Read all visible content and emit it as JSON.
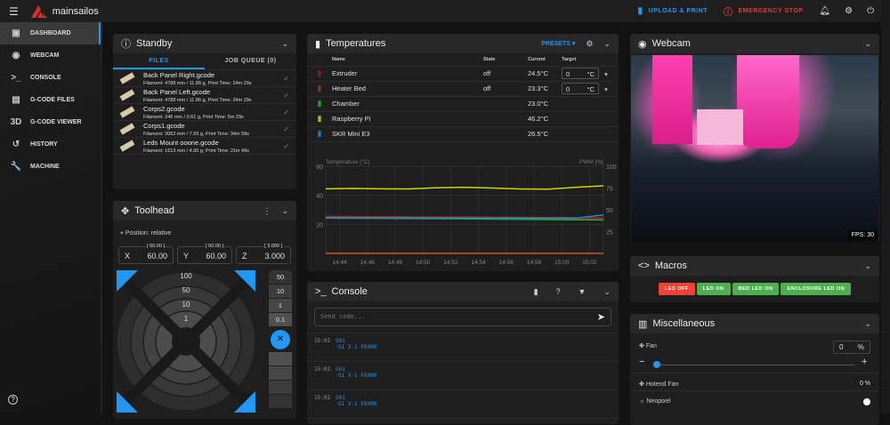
{
  "app": {
    "name": "mainsailos"
  },
  "topbar": {
    "upload": "UPLOAD & PRINT",
    "estop": "EMERGENCY STOP"
  },
  "sidebar": {
    "items": [
      {
        "label": "DASHBOARD",
        "icon": "▣"
      },
      {
        "label": "WEBCAM",
        "icon": "◉"
      },
      {
        "label": "CONSOLE",
        "icon": ">_"
      },
      {
        "label": "G-CODE FILES",
        "icon": "▤"
      },
      {
        "label": "G-CODE VIEWER",
        "icon": "3D"
      },
      {
        "label": "HISTORY",
        "icon": "↺"
      },
      {
        "label": "MACHINE",
        "icon": "🔧"
      }
    ],
    "help": "?"
  },
  "standby": {
    "title": "Standby",
    "tabs": [
      "FILES",
      "JOB QUEUE (0)"
    ],
    "files": [
      {
        "name": "Back Panel Right.gcode",
        "meta": "Filament: 4788 mm / 11.86 g, Print Time: 24m 29s"
      },
      {
        "name": "Back Panel Left.gcode",
        "meta": "Filament: 4788 mm / 11.86 g, Print Time: 24m 29s"
      },
      {
        "name": "Corps2.gcode",
        "meta": "Filament: 246 mm / 0.61 g, Print Time: 5m 29s"
      },
      {
        "name": "Corps1.gcode",
        "meta": "Filament: 3062 mm / 7.59 g, Print Time: 34m 58s"
      },
      {
        "name": "Leds Mount ooone.gcode",
        "meta": "Filament: 1613 mm / 4.00 g, Print Time: 21m 49s"
      }
    ]
  },
  "toolhead": {
    "title": "Toolhead",
    "position": "Position: relative",
    "axes": [
      {
        "axis": "X",
        "value": "60.00",
        "limit": "[ 60.00 ]"
      },
      {
        "axis": "Y",
        "value": "60.00",
        "limit": "[ 60.00 ]"
      },
      {
        "axis": "Z",
        "value": "3.000",
        "limit": "[ 3.000 ]"
      }
    ],
    "xy_steps": [
      "100",
      "50",
      "10",
      "1"
    ],
    "z_steps": [
      "50",
      "10",
      "1",
      "0.1"
    ]
  },
  "temps": {
    "title": "Temperatures",
    "presets": "PRESETS",
    "headers": [
      "Name",
      "State",
      "Current",
      "Target"
    ],
    "rows": [
      {
        "name": "Extruder",
        "state": "off",
        "current": "24.5°C",
        "target": "0",
        "unit": "°C",
        "color": "#8b1a1a"
      },
      {
        "name": "Heater Bed",
        "state": "off",
        "current": "23.3°C",
        "target": "0",
        "unit": "°C",
        "color": "#7a3d16"
      },
      {
        "name": "Chamber",
        "state": "",
        "current": "23.0°C",
        "color": "#1fa31f"
      },
      {
        "name": "Raspberry Pi",
        "state": "",
        "current": "46.2°C",
        "color": "#b8b800"
      },
      {
        "name": "SKR Mini E3",
        "state": "",
        "current": "26.5°C",
        "color": "#1e78c8"
      }
    ]
  },
  "chart_data": {
    "type": "line",
    "ylabel": "Temperature [°C]",
    "y2label": "PWM [%]",
    "ylim": [
      0,
      60
    ],
    "y2lim": [
      0,
      100
    ],
    "yticks": [
      "60",
      "40",
      "20"
    ],
    "y2ticks": [
      "100",
      "75",
      "50",
      "25"
    ],
    "xticks": [
      "14:44",
      "14:46",
      "14:48",
      "14:50",
      "14:52",
      "14:54",
      "14:56",
      "14:58",
      "15:00",
      "15:02"
    ],
    "xrange": [
      0,
      20
    ],
    "series": [
      {
        "name": "Raspberry Pi",
        "color": "#d4d400",
        "x": [
          0,
          2,
          4,
          6,
          8,
          10,
          12,
          14,
          16,
          18,
          20
        ],
        "y": [
          44.5,
          44.8,
          44.5,
          44.4,
          45.2,
          45.5,
          45,
          44.4,
          44.2,
          45.5,
          46.5
        ]
      },
      {
        "name": "Extruder",
        "color": "#c01818",
        "x": [
          0,
          10,
          18,
          20
        ],
        "y": [
          25.5,
          25.0,
          24.6,
          24.5
        ]
      },
      {
        "name": "Heater Bed",
        "color": "#8b3a1a",
        "x": [
          0,
          10,
          20
        ],
        "y": [
          24.8,
          24.2,
          23.3
        ]
      },
      {
        "name": "Chamber",
        "color": "#22b022",
        "x": [
          0,
          10,
          20
        ],
        "y": [
          24.3,
          23.8,
          23.0
        ]
      },
      {
        "name": "SKR Mini E3",
        "color": "#1e88e5",
        "x": [
          0,
          10,
          18,
          20
        ],
        "y": [
          24.5,
          24.3,
          24.3,
          26.5
        ]
      },
      {
        "name": "PWM",
        "color": "#d0502a",
        "x": [
          0,
          20
        ],
        "y": [
          0,
          0
        ]
      }
    ]
  },
  "console": {
    "title": "Console",
    "placeholder": "Send code...",
    "entries": [
      {
        "time": "15:02",
        "cmd1": "G91",
        "cmd2": "G1 X-1 F6000"
      },
      {
        "time": "15:02",
        "cmd1": "G91",
        "cmd2": "G1 X-1 F6000"
      },
      {
        "time": "15:02",
        "cmd1": "G91",
        "cmd2": "G1 X-1 F6000"
      }
    ]
  },
  "webcam": {
    "title": "Webcam",
    "fps": "FPS: 30"
  },
  "macros": {
    "title": "Macros",
    "buttons": [
      {
        "label": "LED OFF",
        "color": "#f44336"
      },
      {
        "label": "LED ON",
        "color": "#4caf50"
      },
      {
        "label": "BED LED ON",
        "color": "#4caf50"
      },
      {
        "label": "ENCLOSURE LED ON",
        "color": "#4caf50"
      }
    ]
  },
  "misc": {
    "title": "Miscellaneous",
    "fan": "Fan",
    "fan_value": "0",
    "fan_unit": "%",
    "fan_fraction": 0,
    "hotend_fan": "Hotend Fan",
    "hotend_value": "0 %",
    "neopixel": "Neopixel"
  }
}
